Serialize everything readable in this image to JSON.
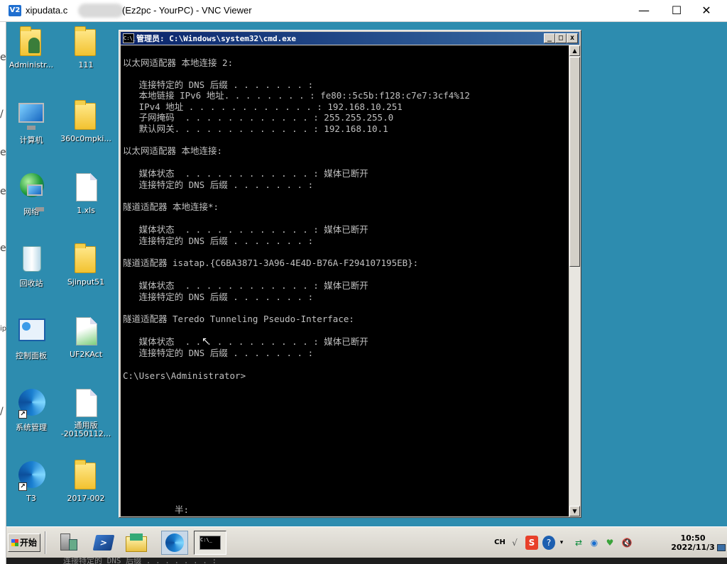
{
  "vnc": {
    "logo": "V2",
    "title_prefix": "xipudata.c",
    "title_suffix": "(Ez2pc - YourPC) - VNC Viewer",
    "minimize": "—",
    "maximize": "☐",
    "close": "✕"
  },
  "left_strip_glyphs": [
    "e",
    "/",
    "e",
    "e",
    "e",
    "ip",
    "/"
  ],
  "desktop": {
    "background": "#2d8caf",
    "icons": [
      {
        "label": "Administr...",
        "icon": "user-folder-icon"
      },
      {
        "label": "111",
        "icon": "folder-icon"
      },
      {
        "label": "计算机",
        "icon": "computer-icon"
      },
      {
        "label": "360c0mpki...",
        "icon": "folder-icon"
      },
      {
        "label": "网络",
        "icon": "network-icon"
      },
      {
        "label": "1.xls",
        "icon": "document-icon"
      },
      {
        "label": "回收站",
        "icon": "recycle-bin-icon"
      },
      {
        "label": "Sjinput51",
        "icon": "folder-icon"
      },
      {
        "label": "控制面板",
        "icon": "control-panel-icon"
      },
      {
        "label": "UF2KAct",
        "icon": "document-icon"
      },
      {
        "label": "系统管理",
        "icon": "app-shortcut-icon"
      },
      {
        "label": "通用版\n-20150112...",
        "icon": "document-icon"
      },
      {
        "label": "T3",
        "icon": "app-shortcut-icon"
      },
      {
        "label": "2017-002",
        "icon": "folder-icon"
      }
    ]
  },
  "cmd": {
    "icon_text": "C:\\_",
    "title": "管理员: C:\\Windows\\system32\\cmd.exe",
    "btn_min": "_",
    "btn_max": "□",
    "btn_close": "x",
    "lines": [
      "以太网适配器 本地连接 2:",
      "",
      "   连接特定的 DNS 后缀 . . . . . . . :",
      "   本地链接 IPv6 地址. . . . . . . . : fe80::5c5b:f128:c7e7:3cf4%12",
      "   IPv4 地址 . . . . . . . . . . . . : 192.168.10.251",
      "   子网掩码  . . . . . . . . . . . . : 255.255.255.0",
      "   默认网关. . . . . . . . . . . . . : 192.168.10.1",
      "",
      "以太网适配器 本地连接:",
      "",
      "   媒体状态  . . . . . . . . . . . . : 媒体已断开",
      "   连接特定的 DNS 后缀 . . . . . . . :",
      "",
      "隧道适配器 本地连接*:",
      "",
      "   媒体状态  . . . . . . . . . . . . : 媒体已断开",
      "   连接特定的 DNS 后缀 . . . . . . . :",
      "",
      "隧道适配器 isatap.{C6BA3871-3A96-4E4D-B76A-F294107195EB}:",
      "",
      "   媒体状态  . . . . . . . . . . . . : 媒体已断开",
      "   连接特定的 DNS 后缀 . . . . . . . :",
      "",
      "隧道适配器 Teredo Tunneling Pseudo-Interface:",
      "",
      "   媒体状态  . . . . . . . . . . . . : 媒体已断开",
      "   连接特定的 DNS 后缀 . . . . . . . :",
      "",
      "C:\\Users\\Administrator>"
    ],
    "ime_status": "半:",
    "cursor_glyph": "↖"
  },
  "taskbar": {
    "start_label": "开始",
    "cmd_task_icon": "C:\\_",
    "tray": {
      "lang": "CH",
      "clock_time": "10:50",
      "clock_date": "2022/11/3"
    }
  },
  "bottom_ghost_text": "连接特定的 DNS 后缀 . . . . . . . :"
}
